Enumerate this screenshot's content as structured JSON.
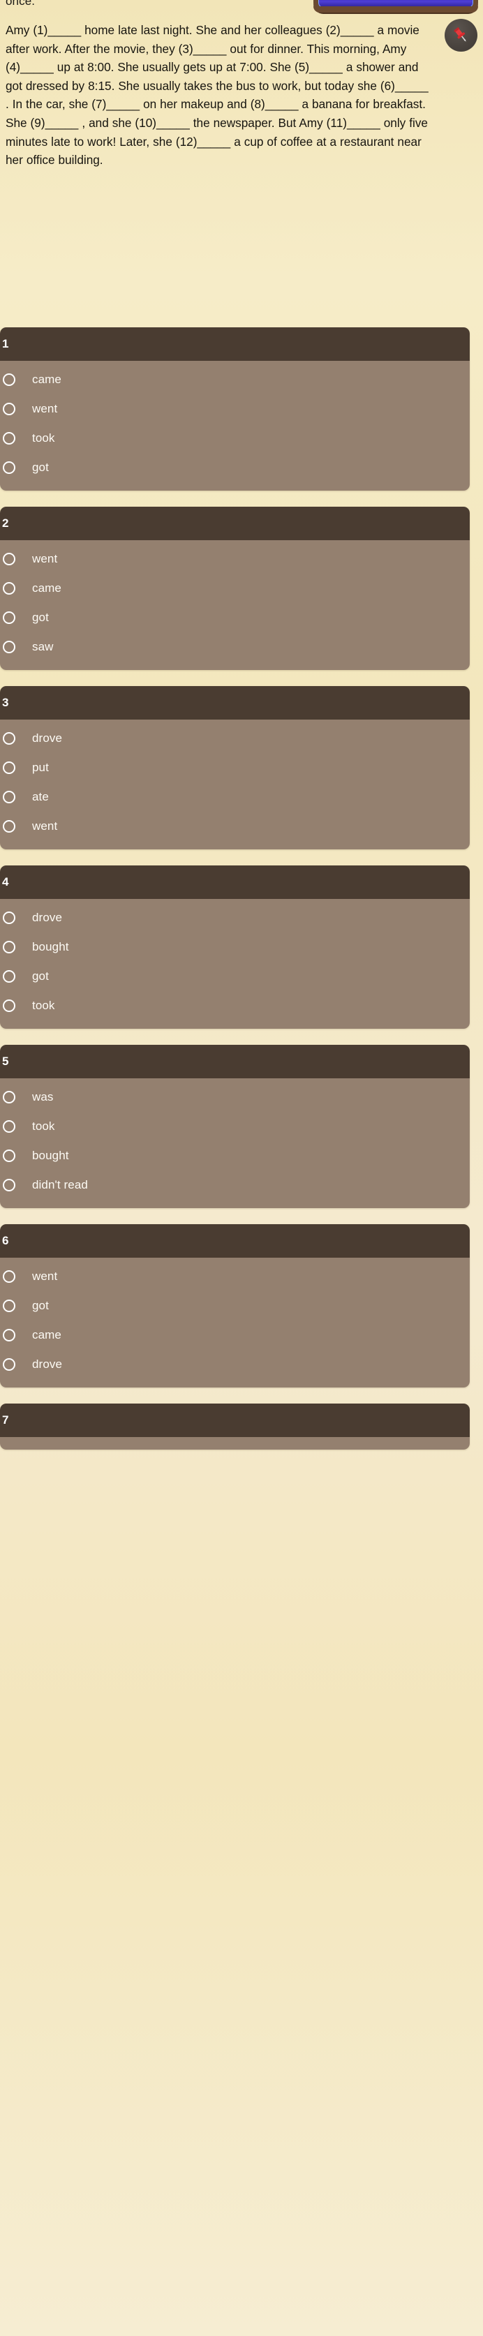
{
  "top": {
    "partial_previous_text": "once.",
    "pin_icon": "pushpin-icon"
  },
  "passage": {
    "text": "Amy (1)_____ home late last night. She and her colleagues (2)_____  a movie after work. After the movie, they (3)_____  out for dinner. This morning, Amy (4)_____ up at 8:00. She usually gets up at 7:00. She (5)_____ a shower and got dressed by 8:15. She usually takes the bus to work, but today she (6)_____ . In the car, she (7)_____  on her makeup and (8)_____  a banana for breakfast. She (9)_____ , and she (10)_____ the newspaper. But Amy (11)_____  only five minutes late to work! Later, she (12)_____  a cup of coffee at a restaurant near her office building."
  },
  "colors": {
    "page_background": "#f3e6bb",
    "card_header": "#4a3c31",
    "card_body": "#94806f",
    "option_text": "#fdfaf4",
    "passage_text": "#17150f",
    "pin_accent": "#e03a3a"
  },
  "questions": [
    {
      "number": "1",
      "options": [
        "came",
        "went",
        "took",
        "got"
      ]
    },
    {
      "number": "2",
      "options": [
        "went",
        "came",
        "got",
        "saw"
      ]
    },
    {
      "number": "3",
      "options": [
        "drove",
        "put",
        "ate",
        "went"
      ]
    },
    {
      "number": "4",
      "options": [
        "drove",
        "bought",
        "got",
        "took"
      ]
    },
    {
      "number": "5",
      "options": [
        "was",
        "took",
        "bought",
        "didn't read"
      ]
    },
    {
      "number": "6",
      "options": [
        "went",
        "got",
        "came",
        "drove"
      ]
    },
    {
      "number": "7",
      "options": []
    }
  ]
}
